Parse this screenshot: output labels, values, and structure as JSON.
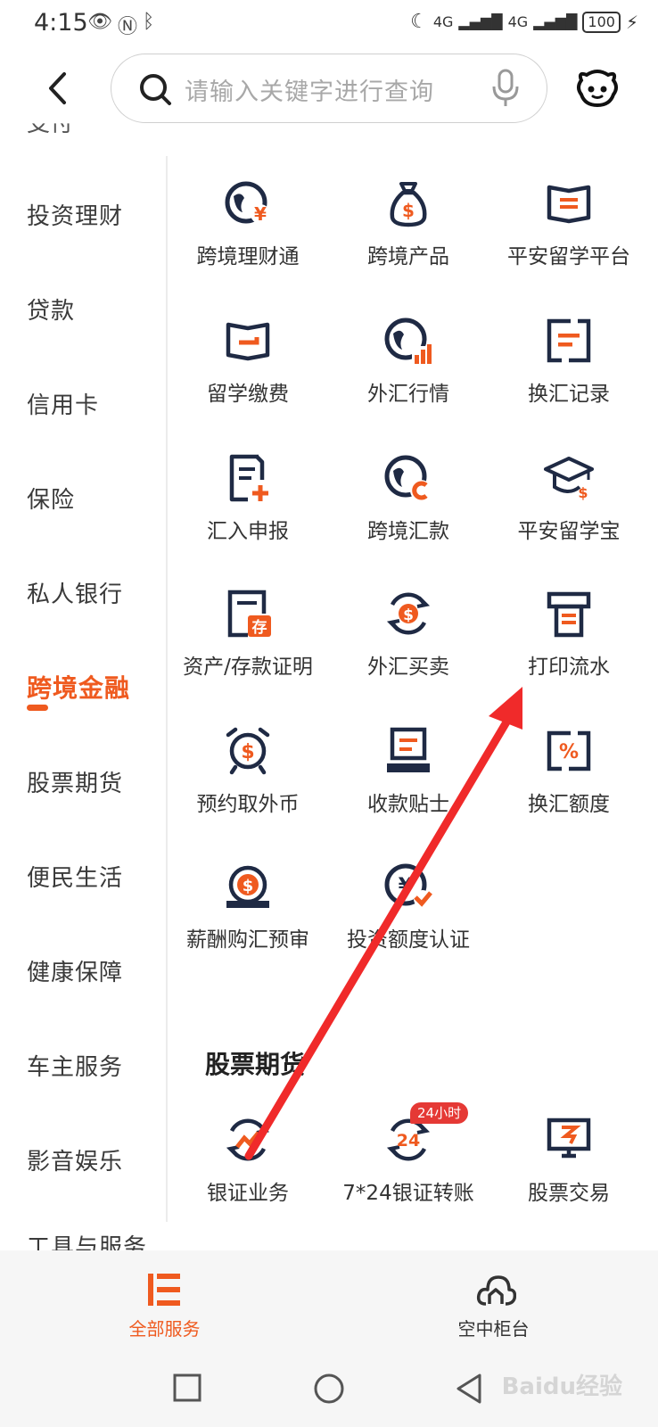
{
  "status": {
    "time": "4:15",
    "signal1": "4G",
    "signal2": "4G",
    "battery": "100"
  },
  "search": {
    "placeholder": "请输入关键字进行查询"
  },
  "sidebar": {
    "cut_top": "支付",
    "items": [
      {
        "label": "投资理财"
      },
      {
        "label": "贷款"
      },
      {
        "label": "信用卡"
      },
      {
        "label": "保险"
      },
      {
        "label": "私人银行"
      },
      {
        "label": "跨境金融",
        "active": true
      },
      {
        "label": "股票期货"
      },
      {
        "label": "便民生活"
      },
      {
        "label": "健康保障"
      },
      {
        "label": "车主服务"
      },
      {
        "label": "影音娱乐"
      }
    ],
    "cut_bottom": "工具与服务"
  },
  "cross_border": {
    "items": [
      {
        "label": "跨境理财通",
        "icon": "globe-yen-icon"
      },
      {
        "label": "跨境产品",
        "icon": "money-bag-icon"
      },
      {
        "label": "平安留学平台",
        "icon": "open-book-icon"
      },
      {
        "label": "留学缴费",
        "icon": "book-payment-icon"
      },
      {
        "label": "外汇行情",
        "icon": "globe-chart-icon"
      },
      {
        "label": "换汇记录",
        "icon": "exchange-record-icon"
      },
      {
        "label": "汇入申报",
        "icon": "document-plus-icon"
      },
      {
        "label": "跨境汇款",
        "icon": "globe-remit-icon"
      },
      {
        "label": "平安留学宝",
        "icon": "graduation-cap-icon"
      },
      {
        "label": "资产/存款证明",
        "icon": "deposit-certificate-icon"
      },
      {
        "label": "外汇买卖",
        "icon": "dollar-exchange-icon"
      },
      {
        "label": "打印流水",
        "icon": "printer-icon"
      },
      {
        "label": "预约取外币",
        "icon": "alarm-dollar-icon"
      },
      {
        "label": "收款贴士",
        "icon": "receipt-tips-icon"
      },
      {
        "label": "换汇额度",
        "icon": "percent-quota-icon"
      },
      {
        "label": "薪酬购汇预审",
        "icon": "salary-dollar-icon"
      },
      {
        "label": "投资额度认证",
        "icon": "globe-yen-check-icon"
      }
    ]
  },
  "stocks": {
    "title": "股票期货",
    "items": [
      {
        "label": "银证业务",
        "icon": "stock-trend-icon"
      },
      {
        "label": "7*24银证转账",
        "icon": "transfer-24-icon",
        "badge": "24小时",
        "inner": "24"
      },
      {
        "label": "股票交易",
        "icon": "monitor-stock-icon"
      }
    ]
  },
  "tabs": [
    {
      "label": "全部服务",
      "icon": "all-services-icon",
      "active": true
    },
    {
      "label": "空中柜台",
      "icon": "cloud-counter-icon",
      "active": false
    }
  ],
  "watermark": "Baidu经验",
  "colors": {
    "accent": "#ef5a1f",
    "icon_dark": "#1f2a44",
    "badge_red": "#e53935",
    "annotation_arrow": "#f02a2a"
  }
}
